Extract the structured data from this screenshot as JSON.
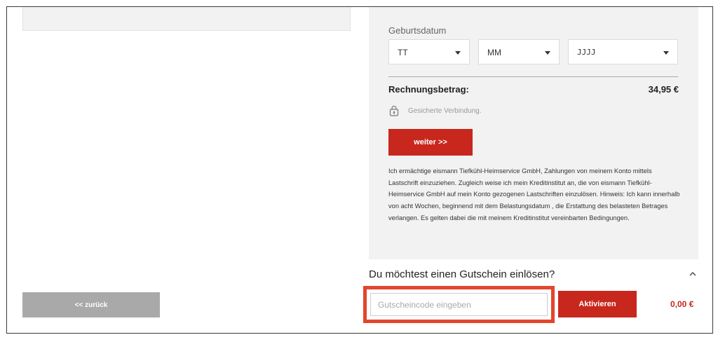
{
  "payment": {
    "dob_label": "Geburtsdatum",
    "day_value": "TT",
    "month_value": "MM",
    "year_value": "JJJJ",
    "total_label": "Rechnungsbetrag:",
    "total_value": "34,95 €",
    "secure_text": "Gesicherte Verbindung.",
    "continue_label": "weiter >>",
    "mandate_text": "Ich ermächtige eismann Tiefkühl-Heimservice GmbH, Zahlungen von meinem Konto mittels Lastschrift einzuziehen. Zugleich weise ich mein Kreditinstitut an, die von eismann Tiefkühl-Heimservice GmbH auf mein Konto gezogenen Lastschriften einzulösen. Hinweis: Ich kann innerhalb von acht Wochen, beginnend mit dem Belastungsdatum , die Erstattung des belasteten Betrages verlangen. Es gelten dabei die mit meinem Kreditinstitut vereinbarten Bedingungen."
  },
  "voucher": {
    "title": "Du möchtest einen Gutschein einlösen?",
    "input_placeholder": "Gutscheincode eingeben",
    "activate_label": "Aktivieren",
    "amount": "0,00 €"
  },
  "navigation": {
    "back_label": "<< zurück"
  },
  "icons": {
    "secure": "lock-icon",
    "voucher_toggle": "chevron-up-icon",
    "select_caret": "caret-down-icon"
  },
  "colors": {
    "accent": "#c8271d",
    "highlight_border": "#e2462c",
    "panel_bg": "#f2f2f2",
    "back_button_bg": "#a9a9a9"
  }
}
